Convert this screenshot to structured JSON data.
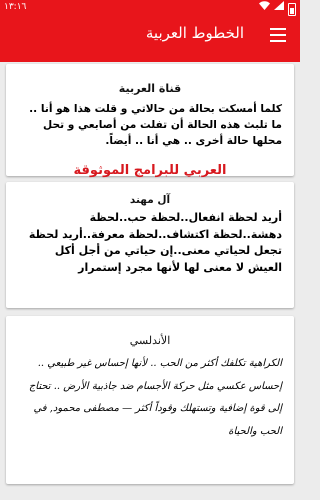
{
  "status_bar": {
    "time": "١٣:١٦",
    "wifi_icon": "wifi-icon",
    "signal_icon": "signal-icon",
    "battery_icon": "battery-icon"
  },
  "app_bar": {
    "title": "الخطوط العربية",
    "menu_icon": "hamburger-menu-icon"
  },
  "watermark": "العربي للبرامج الموثوقة",
  "cards": [
    {
      "title": "قناة العربية",
      "text": "كلما أمسكت بحالة من حالاتي و قلت هذا هو أنا .. ما تلبث هذه الحالة أن تفلت من أصابعي و تحل محلها حالة أخرى .. هي أنا .. أيضاً."
    },
    {
      "title": "آل مهند",
      "text": "أريد لحظة انفعال..لحظة حب..لحظة دهشة..لحظة اكتشاف..لحظة معرفة..أريد لحظة تجعل لحياتي معنى..إن حياتي من أجل أكل العيش لا معنى لها لأنها مجرد إستمرار"
    },
    {
      "title": "الأندلسي",
      "text": "الكراهية تكلفك أكثر من الحب .. لأنها إحساس غير طبيعي .. إحساس عكسي مثل حركة الأجسام ضد جاذبية الأرض .. تحتاج إلى قوة إضافية وتستهلك وقوداً أكثر — مصطفى محمود, في الحب والحياة"
    }
  ],
  "colors": {
    "brand_red": "#e8151b",
    "background": "#ececec",
    "watermark_red": "#d7191f"
  }
}
